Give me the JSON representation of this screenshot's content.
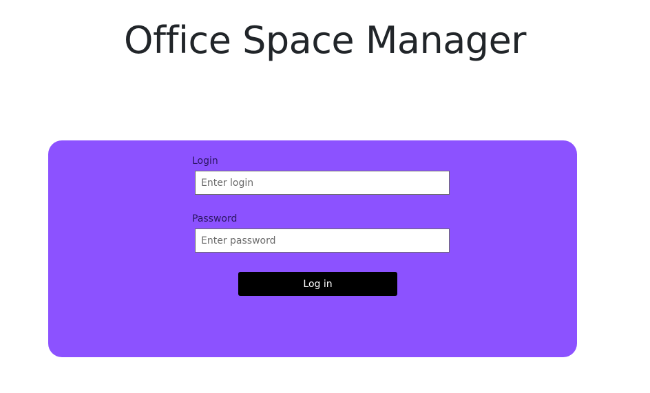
{
  "page": {
    "title": "Office Space Manager"
  },
  "login_form": {
    "login_label": "Login",
    "login_value": "",
    "login_placeholder": "Enter login",
    "password_label": "Password",
    "password_value": "",
    "password_placeholder": "Enter password",
    "submit_label": "Log in"
  },
  "colors": {
    "card_background": "#8c52ff",
    "button_background": "#000000",
    "title_text": "#212529"
  }
}
